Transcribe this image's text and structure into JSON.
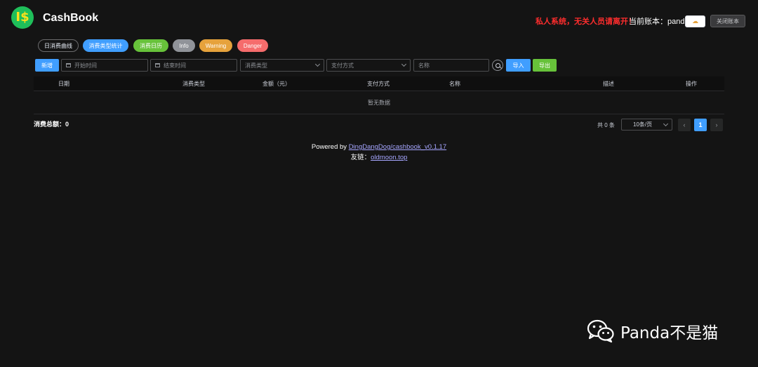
{
  "header": {
    "logo_text": "I$",
    "app_title": "CashBook",
    "warning": "私人系统，无关人员请离开！",
    "account_label": "当前账本：panda",
    "theme_icon": "moon-cloud-icon",
    "close_book_label": "关闭账本"
  },
  "nav_pills": [
    {
      "label": "日消费曲线",
      "color": "#141414"
    },
    {
      "label": "消费类型统计",
      "color": "#409eff"
    },
    {
      "label": "消费日历",
      "color": "#67c23a"
    },
    {
      "label": "Info",
      "color": "#909399"
    },
    {
      "label": "Warning",
      "color": "#e6a23c"
    },
    {
      "label": "Danger",
      "color": "#f56c6c"
    }
  ],
  "toolbar": {
    "add_label": "新增",
    "start_date_placeholder": "开始时间",
    "end_date_placeholder": "结束时间",
    "type_placeholder": "消费类型",
    "payment_placeholder": "支付方式",
    "name_placeholder": "名称",
    "import_label": "导入",
    "export_label": "导出"
  },
  "table": {
    "columns": [
      "日期",
      "消费类型",
      "金额（元）",
      "支付方式",
      "名称",
      "描述",
      "操作"
    ],
    "empty_text": "暂无数据"
  },
  "summary": {
    "total_label": "消费总额：0"
  },
  "pagination": {
    "total_text": "共 0 条",
    "page_size": "10条/页",
    "current_page": "1",
    "prev": "‹",
    "next": "›"
  },
  "footer": {
    "powered_prefix": "Powered by ",
    "powered_link": "DingDangDog/cashbook_v0.1.17",
    "friend_prefix": "友链：",
    "friend_link": "oldmoon.top"
  },
  "watermark": {
    "text": "Panda不是猫",
    "icon": "wechat-icon"
  }
}
